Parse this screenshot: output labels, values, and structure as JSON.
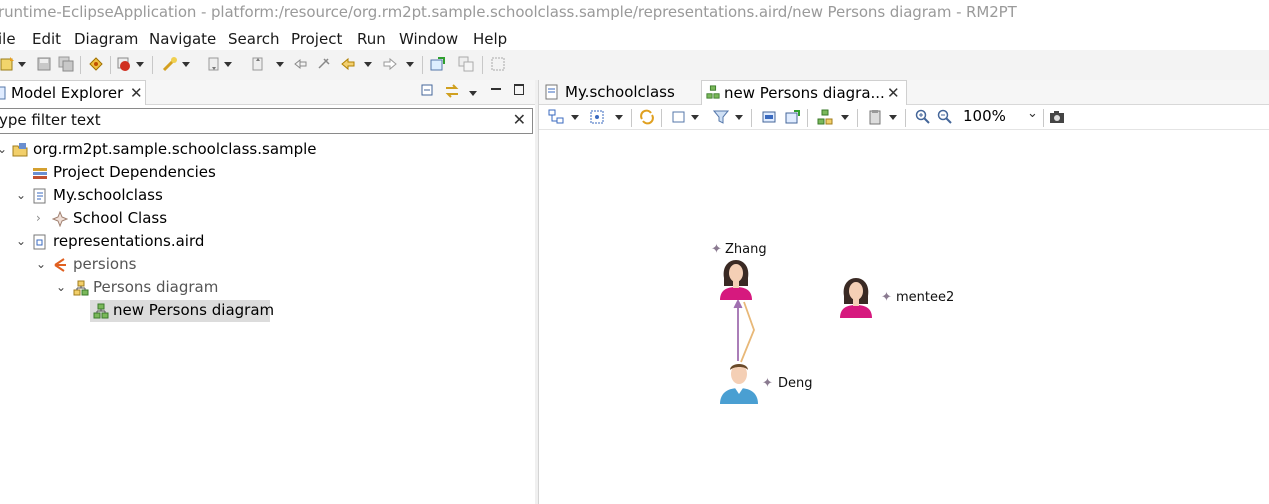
{
  "window": {
    "title": "runtime-EclipseApplication - platform:/resource/org.rm2pt.sample.schoolclass.sample/representations.aird/new Persons diagram - RM2PT"
  },
  "menu": [
    "ile",
    "Edit",
    "Diagram",
    "Navigate",
    "Search",
    "Project",
    "Run",
    "Window",
    "Help"
  ],
  "explorer": {
    "tab_label": "Model Explorer",
    "filter_placeholder": "ype filter text",
    "tree": [
      {
        "label": "org.rm2pt.sample.schoolclass.sample",
        "icon": "project-folder-icon"
      },
      {
        "label": "Project Dependencies",
        "icon": "library-icon"
      },
      {
        "label": "My.schoolclass",
        "icon": "model-file-icon"
      },
      {
        "label": "School Class",
        "icon": "class-element-icon"
      },
      {
        "label": "representations.aird",
        "icon": "aird-file-icon"
      },
      {
        "label": "persions",
        "icon": "viewpoint-icon"
      },
      {
        "label": "Persons diagram",
        "icon": "diagram-description-icon"
      },
      {
        "label": "new Persons diagram",
        "icon": "diagram-icon",
        "selected": true
      }
    ]
  },
  "editor": {
    "tabs": [
      {
        "label": "My.schoolclass",
        "active": false
      },
      {
        "label": "new Persons diagra...",
        "active": true
      }
    ],
    "zoom": "100%",
    "nodes": [
      {
        "label": "Zhang",
        "kind": "female-person"
      },
      {
        "label": "mentee2",
        "kind": "female-person"
      },
      {
        "label": "Deng",
        "kind": "male-person"
      }
    ],
    "colors": {
      "female_shirt": "#d6197e",
      "male_shirt": "#4a9fd2",
      "edge_purple": "#a070b0",
      "edge_orange": "#e8b878"
    }
  }
}
